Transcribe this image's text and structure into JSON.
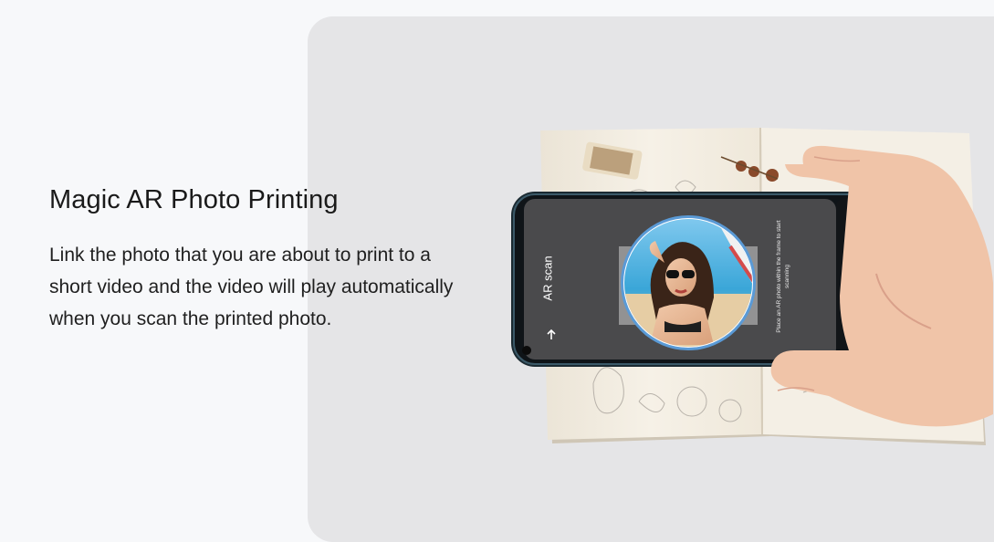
{
  "feature": {
    "title": "Magic AR Photo Printing",
    "description": "Link the photo that you are about to print to a short video and the video will play automatically when you scan the printed photo."
  },
  "phone_screen": {
    "title": "AR scan",
    "hint": "Place an AR photo within the frame to start scanning"
  },
  "colors": {
    "page_background": "#f7f8fa",
    "panel": "#e5e5e7",
    "phone_screen": "#4a4a4c",
    "scan_ring": "#5a9ad6"
  },
  "icons": [
    "back-arrow-icon",
    "camera-icon",
    "square-nav-icon",
    "circle-nav-icon",
    "triangle-nav-icon",
    "heart-doodle-icon"
  ]
}
